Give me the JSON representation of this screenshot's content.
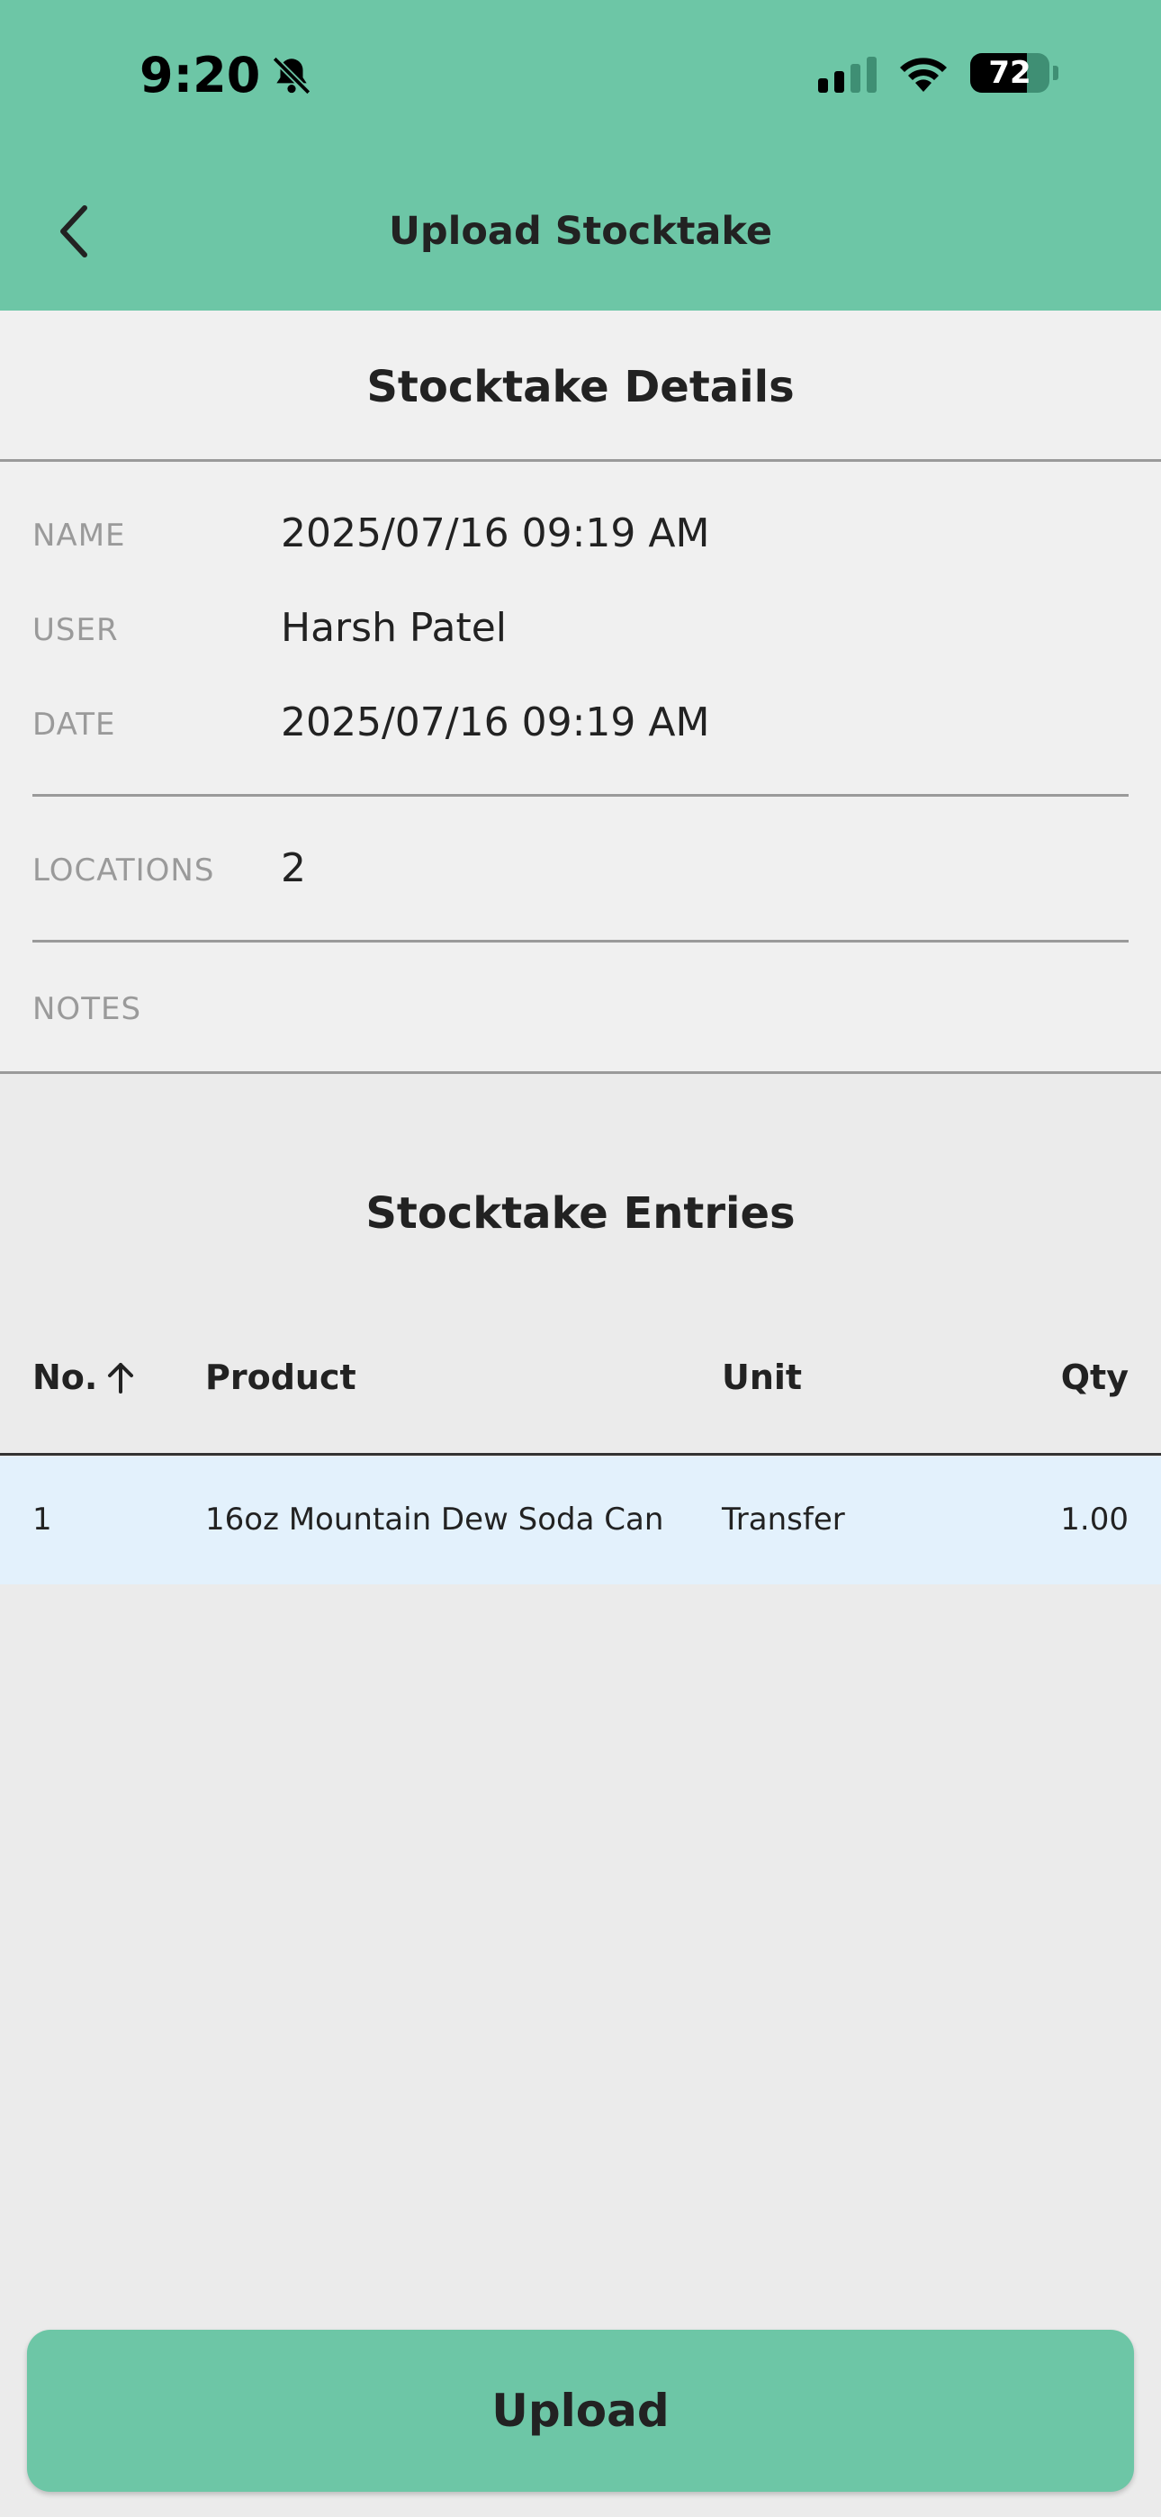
{
  "status_bar": {
    "time": "9:20",
    "battery": "72"
  },
  "nav": {
    "title": "Upload Stocktake"
  },
  "details": {
    "title": "Stocktake Details",
    "name_label": "NAME",
    "name_value": "2025/07/16 09:19 AM",
    "user_label": "USER",
    "user_value": "Harsh Patel",
    "date_label": "DATE",
    "date_value": "2025/07/16 09:19 AM",
    "locations_label": "LOCATIONS",
    "locations_value": "2",
    "notes_label": "NOTES"
  },
  "entries": {
    "title": "Stocktake Entries",
    "columns": {
      "no": "No.",
      "product": "Product",
      "unit": "Unit",
      "qty": "Qty"
    },
    "rows": [
      {
        "no": "1",
        "product": "16oz Mountain Dew Soda Can",
        "unit": "Transfer",
        "qty": "1.00"
      }
    ]
  },
  "actions": {
    "upload_label": "Upload"
  },
  "colors": {
    "accent": "#6dc6a6",
    "row_highlight": "#e3f1fc",
    "background": "#ebebeb"
  }
}
